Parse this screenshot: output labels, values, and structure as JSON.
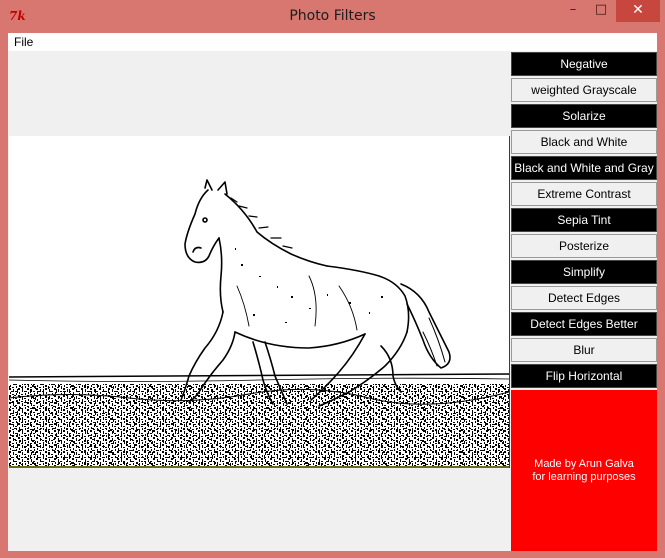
{
  "window": {
    "title": "Photo Filters",
    "icon": "tk-feather-icon",
    "controls": {
      "minimize": "–",
      "maximize": "□",
      "close": "✕"
    }
  },
  "menu": {
    "file": "File"
  },
  "filters": [
    {
      "label": "Negative",
      "style": "dark"
    },
    {
      "label": "weighted Grayscale",
      "style": "light"
    },
    {
      "label": "Solarize",
      "style": "dark"
    },
    {
      "label": "Black and White",
      "style": "light"
    },
    {
      "label": "Black and White and Gray",
      "style": "dark"
    },
    {
      "label": "Extreme Contrast",
      "style": "light"
    },
    {
      "label": "Sepia Tint",
      "style": "dark"
    },
    {
      "label": "Posterize",
      "style": "light"
    },
    {
      "label": "Simplify",
      "style": "dark"
    },
    {
      "label": "Detect Edges",
      "style": "light"
    },
    {
      "label": "Detect Edges Better",
      "style": "dark"
    },
    {
      "label": "Blur",
      "style": "light"
    },
    {
      "label": "Flip Horizontal",
      "style": "dark"
    }
  ],
  "credit": {
    "line1": "Made by Arun Galva",
    "line2": "for learning purposes"
  },
  "image": {
    "subject": "horse-edge-detected-photo"
  },
  "colors": {
    "titlebar": "#d8776f",
    "credit_bg": "#ff0000",
    "dark_button": "#000000"
  }
}
